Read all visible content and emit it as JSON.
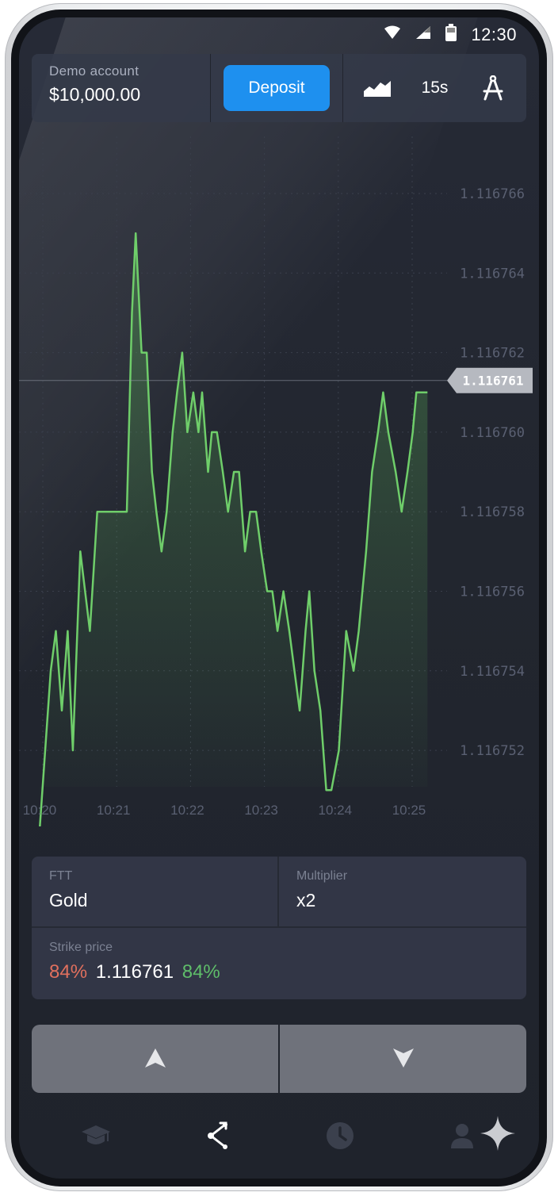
{
  "status_bar": {
    "time": "12:30",
    "icons": [
      "wifi-icon",
      "signal-icon",
      "battery-icon"
    ]
  },
  "header": {
    "account_label": "Demo account",
    "balance": "$10,000.00",
    "deposit_label": "Deposit",
    "chart_type_icon": "area-chart-icon",
    "timeframe": "15s",
    "drawing_tools_icon": "compass-ruler-icon"
  },
  "chart_data": {
    "type": "area",
    "x_tick_labels": [
      "10:20",
      "10:21",
      "10:22",
      "10:23",
      "10:24",
      "10:25"
    ],
    "y_tick_labels": [
      "1.116766",
      "1.116764",
      "1.116762",
      "1.116760",
      "1.116758",
      "1.116756",
      "1.116754",
      "1.116752"
    ],
    "ylim": [
      1.11675,
      1.116768
    ],
    "current_price": "1.116761",
    "current_price_value": 1.1167613,
    "line_color": "#6fce6a",
    "x": [
      0,
      0.15,
      0.22,
      0.3,
      0.38,
      0.45,
      0.55,
      0.68,
      0.78,
      0.88,
      0.95,
      1.02,
      1.1,
      1.18,
      1.25,
      1.3,
      1.38,
      1.45,
      1.52,
      1.58,
      1.65,
      1.72,
      1.8,
      1.86,
      1.93,
      2.0,
      2.08,
      2.15,
      2.2,
      2.28,
      2.33,
      2.4,
      2.48,
      2.55,
      2.63,
      2.7,
      2.78,
      2.85,
      2.93,
      3.0,
      3.08,
      3.15,
      3.22,
      3.3,
      3.38,
      3.45,
      3.52,
      3.6,
      3.65,
      3.72,
      3.8,
      3.88,
      3.95,
      4.05,
      4.15,
      4.25,
      4.32,
      4.42,
      4.5,
      4.58,
      4.65,
      4.72,
      4.82,
      4.9,
      4.98,
      5.05,
      5.1,
      5.18,
      5.25
    ],
    "y": [
      1.11675,
      1.116754,
      1.116755,
      1.116753,
      1.116755,
      1.116752,
      1.116757,
      1.116755,
      1.116758,
      1.116758,
      1.116758,
      1.116758,
      1.116758,
      1.116758,
      1.116763,
      1.116765,
      1.116762,
      1.116762,
      1.116759,
      1.116758,
      1.116757,
      1.116758,
      1.11676,
      1.116761,
      1.116762,
      1.11676,
      1.116761,
      1.11676,
      1.116761,
      1.116759,
      1.11676,
      1.11676,
      1.116759,
      1.116758,
      1.116759,
      1.116759,
      1.116757,
      1.116758,
      1.116758,
      1.116757,
      1.116756,
      1.116756,
      1.116755,
      1.116756,
      1.116755,
      1.116754,
      1.116753,
      1.116755,
      1.116756,
      1.116754,
      1.116753,
      1.116751,
      1.116751,
      1.116752,
      1.116755,
      1.116754,
      1.116755,
      1.116757,
      1.116759,
      1.11676,
      1.116761,
      1.11676,
      1.116759,
      1.116758,
      1.116759,
      1.11676,
      1.116761,
      1.116761,
      1.116761
    ],
    "grid": true
  },
  "panel": {
    "ftt_label": "FTT",
    "ftt_value": "Gold",
    "multiplier_label": "Multiplier",
    "multiplier_value": "x2",
    "strike_label": "Strike price",
    "strike_pct_left": "84%",
    "strike_value": "1.116761",
    "strike_pct_right": "84%"
  },
  "buttons": {
    "up_icon": "arrow-up-icon",
    "down_icon": "arrow-down-icon"
  },
  "nav": {
    "items": [
      {
        "icon": "graduation-cap-icon",
        "active": false
      },
      {
        "icon": "trading-icon",
        "active": true
      },
      {
        "icon": "clock-icon",
        "active": false
      },
      {
        "icon": "user-icon",
        "active": false
      }
    ]
  }
}
